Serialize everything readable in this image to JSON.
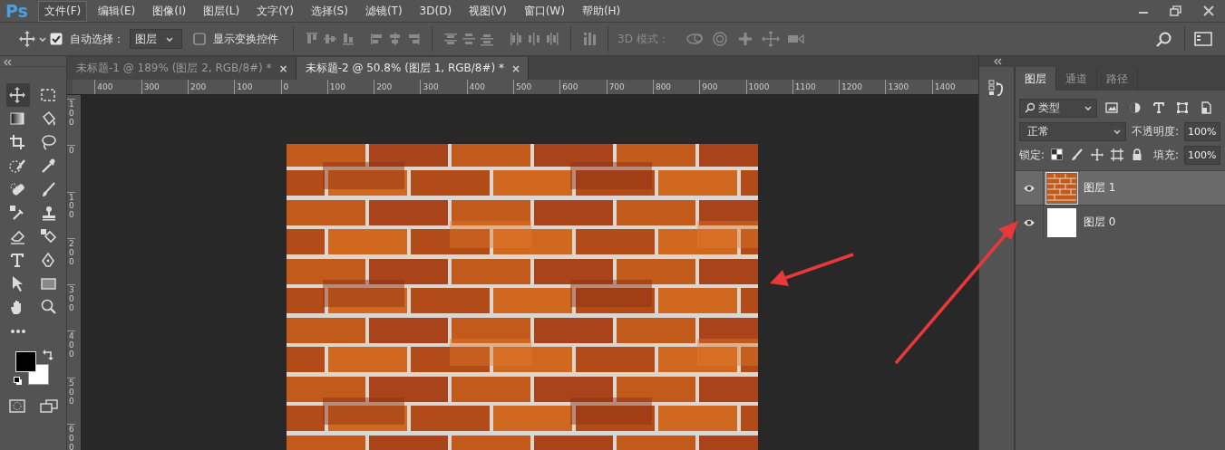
{
  "app": {
    "logo": "Ps"
  },
  "menu": [
    {
      "label": "文件(F)",
      "selected": true
    },
    {
      "label": "编辑(E)",
      "selected": false
    },
    {
      "label": "图像(I)",
      "selected": false
    },
    {
      "label": "图层(L)",
      "selected": false
    },
    {
      "label": "文字(Y)",
      "selected": false
    },
    {
      "label": "选择(S)",
      "selected": false
    },
    {
      "label": "滤镜(T)",
      "selected": false
    },
    {
      "label": "3D(D)",
      "selected": false
    },
    {
      "label": "视图(V)",
      "selected": false
    },
    {
      "label": "窗口(W)",
      "selected": false
    },
    {
      "label": "帮助(H)",
      "selected": false
    }
  ],
  "options_bar": {
    "auto_select": {
      "label": "自动选择：",
      "checked": true
    },
    "target": {
      "value": "图层"
    },
    "show_transform": {
      "label": "显示变换控件",
      "checked": false
    },
    "mode_3d_label": "3D 模式："
  },
  "tabs": [
    {
      "label": "未标题-1 @ 189% (图层 2, RGB/8#) *",
      "close": "×",
      "selected": false
    },
    {
      "label": "未标题-2 @ 50.8% (图层 1, RGB/8#) *",
      "close": "×",
      "selected": true
    }
  ],
  "rulers": {
    "horizontal": [
      "400",
      "300",
      "200",
      "100",
      "0",
      "100",
      "200",
      "300",
      "400",
      "500",
      "600",
      "700",
      "800",
      "900",
      "1000",
      "1100",
      "1200",
      "1300",
      "1400"
    ],
    "vertical": [
      "100",
      "0",
      "100",
      "200",
      "300",
      "400",
      "500",
      "600"
    ]
  },
  "layers_panel": {
    "tabs": [
      {
        "label": "图层",
        "selected": true
      },
      {
        "label": "通道",
        "selected": false
      },
      {
        "label": "路径",
        "selected": false
      }
    ],
    "filter": {
      "value": "类型"
    },
    "blend_mode": {
      "value": "正常"
    },
    "opacity": {
      "label": "不透明度:",
      "value": "100%"
    },
    "lock_label": "锁定:",
    "fill": {
      "label": "填充:",
      "value": "100%"
    },
    "layers": [
      {
        "name": "图层 1",
        "kind": "brick",
        "visible": true,
        "selected": true
      },
      {
        "name": "图层 0",
        "kind": "white",
        "visible": true,
        "selected": false
      }
    ]
  }
}
